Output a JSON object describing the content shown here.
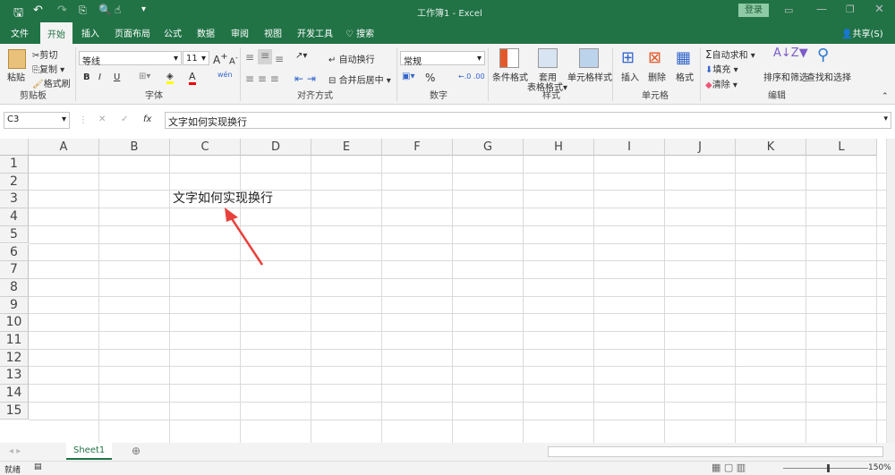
{
  "titlebar": {
    "title": "工作簿1  -  Excel",
    "login": "登录"
  },
  "tabs": [
    "文件",
    "开始",
    "插入",
    "页面布局",
    "公式",
    "数据",
    "审阅",
    "视图",
    "开发工具"
  ],
  "search": "搜索",
  "share": "共享(S)",
  "ribbon": {
    "clipboard": {
      "paste": "粘贴",
      "cut": "剪切",
      "copy": "复制",
      "format_painter": "格式刷",
      "label": "剪贴板"
    },
    "font": {
      "name": "等线",
      "size": "11",
      "label": "字体",
      "bold": "B",
      "italic": "I",
      "underline": "U"
    },
    "align": {
      "wrap": "自动换行",
      "merge": "合并后居中",
      "label": "对齐方式"
    },
    "number": {
      "format": "常规",
      "percent": "%",
      "label": "数字"
    },
    "styles": {
      "conditional": "条件格式",
      "table1": "套用",
      "table2": "表格格式",
      "cell_styles": "单元格样式",
      "label": "样式"
    },
    "cells": {
      "insert": "插入",
      "delete": "删除",
      "format": "格式",
      "label": "单元格"
    },
    "editing": {
      "autosum": "自动求和",
      "fill": "填充",
      "clear": "清除",
      "sort": "排序和筛选",
      "find": "查找和选择",
      "label": "编辑"
    }
  },
  "formula_bar": {
    "name_box": "C3",
    "fx": "fx",
    "content": "文字如何实现换行"
  },
  "columns": [
    "A",
    "B",
    "C",
    "D",
    "E",
    "F",
    "G",
    "H",
    "I",
    "J",
    "K",
    "L"
  ],
  "rows": [
    "1",
    "2",
    "3",
    "4",
    "5",
    "6",
    "7",
    "8",
    "9",
    "10",
    "11",
    "12",
    "13",
    "14",
    "15"
  ],
  "cells": {
    "C3": "文字如何实现换行"
  },
  "sheets": [
    "Sheet1"
  ],
  "status": {
    "ready": "就绪",
    "zoom": "150%"
  },
  "colors": {
    "accent": "#217346",
    "arrow": "#e8413c"
  }
}
